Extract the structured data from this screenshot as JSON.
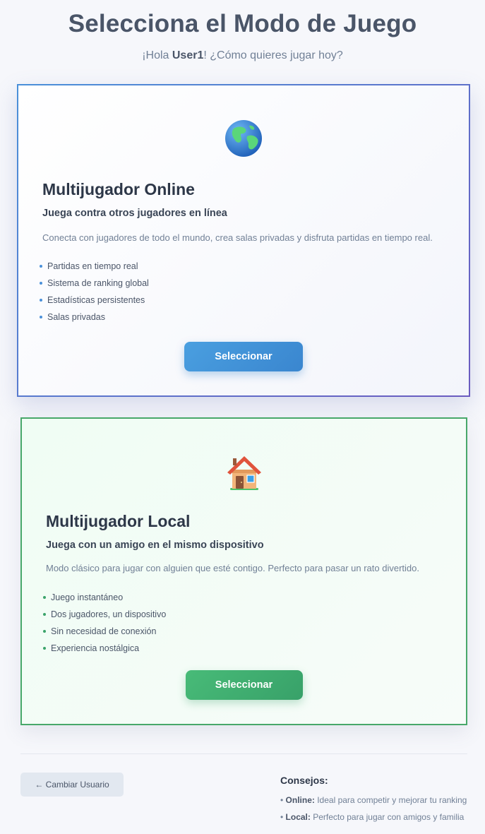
{
  "header": {
    "title": "Selecciona el Modo de Juego",
    "greeting_prefix": "¡Hola ",
    "username": "User1",
    "greeting_suffix": "! ¿Cómo quieres jugar hoy?"
  },
  "modes": {
    "online": {
      "icon": "globe-icon",
      "title": "Multijugador Online",
      "subtitle": "Juega contra otros jugadores en línea",
      "description": "Conecta con jugadores de todo el mundo, crea salas privadas y disfruta partidas en tiempo real.",
      "features": [
        "Partidas en tiempo real",
        "Sistema de ranking global",
        "Estadísticas persistentes",
        "Salas privadas"
      ],
      "button_label": "Seleccionar",
      "accent": "#4a90d9"
    },
    "local": {
      "icon": "house-icon",
      "title": "Multijugador Local",
      "subtitle": "Juega con un amigo en el mismo dispositivo",
      "description": "Modo clásico para jugar con alguien que esté contigo. Perfecto para pasar un rato divertido.",
      "features": [
        "Juego instantáneo",
        "Dos jugadores, un dispositivo",
        "Sin necesidad de conexión",
        "Experiencia nostálgica"
      ],
      "button_label": "Seleccionar",
      "accent": "#48a86a"
    }
  },
  "footer": {
    "change_user_label": "← Cambiar Usuario",
    "tips_title": "Consejos:",
    "tips": [
      {
        "bullet": "• ",
        "label": "Online:",
        "text": " Ideal para competir y mejorar tu ranking"
      },
      {
        "bullet": "• ",
        "label": "Local:",
        "text": " Perfecto para jugar con amigos y familia"
      }
    ]
  }
}
